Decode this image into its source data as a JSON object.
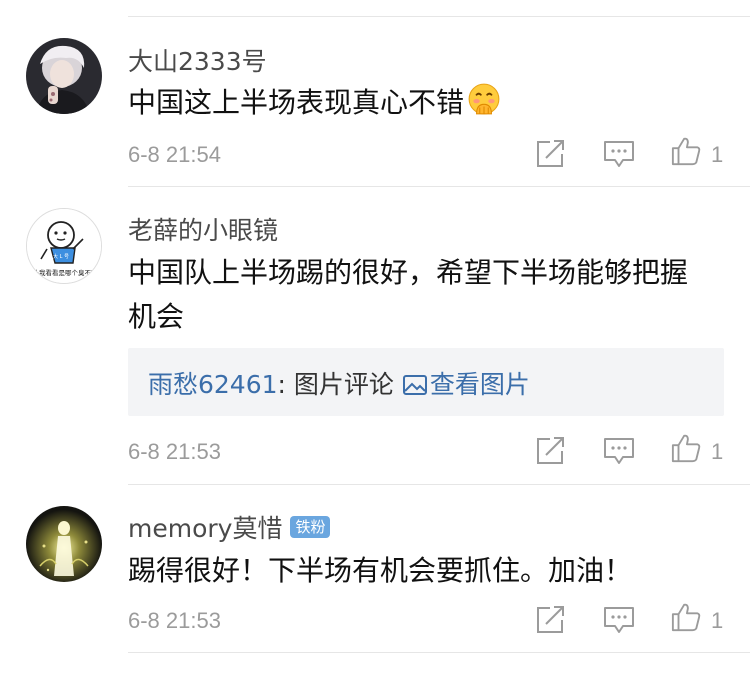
{
  "comments": [
    {
      "username": "大山2333号",
      "text": "中国这上半场表现真心不错",
      "emoji": "🤭",
      "time": "6-8 21:54",
      "likes": "1"
    },
    {
      "username": "老薛的小眼镜",
      "text": "中国队上半场踢的很好，希望下半场能够把握机会",
      "time": "6-8 21:53",
      "likes": "1",
      "avatar_caption": "让我看看是哪个臭不要",
      "quote": {
        "user": "雨愁62461",
        "separator": ": ",
        "label": "图片评论",
        "link": "查看图片"
      }
    },
    {
      "username": "memory莫惜",
      "badge": "铁粉",
      "text": "踢得很好！下半场有机会要抓住。加油！",
      "time": "6-8 21:53",
      "likes": "1"
    }
  ],
  "icons": {
    "share": "share-icon",
    "comment": "comment-icon",
    "like": "thumbs-up-icon",
    "image": "image-icon"
  },
  "colors": {
    "link": "#3b6eaa",
    "meta": "#9b9b9b",
    "badge": "#6aa6df",
    "quote_bg": "#f3f4f6"
  }
}
